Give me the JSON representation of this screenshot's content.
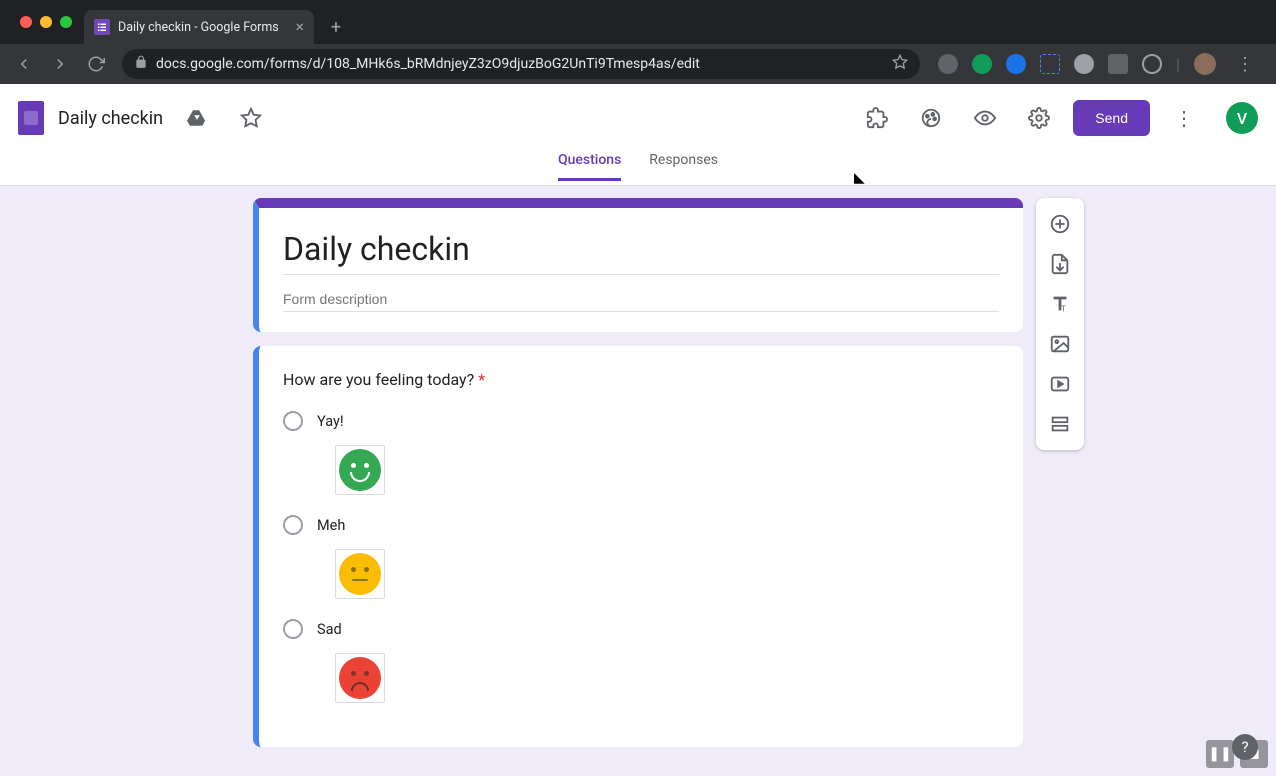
{
  "browser": {
    "tab_title": "Daily checkin - Google Forms",
    "url": "docs.google.com/forms/d/108_MHk6s_bRMdnjeyZ3zO9djuzBoG2UnTi9Tmesp4as/edit"
  },
  "header": {
    "form_name": "Daily checkin",
    "send_label": "Send",
    "avatar_letter": "V"
  },
  "tabs": {
    "questions": "Questions",
    "responses": "Responses"
  },
  "form": {
    "title": "Daily checkin",
    "desc_placeholder": "Form description",
    "question": {
      "text": "How are you feeling today?",
      "options": [
        {
          "label": "Yay!",
          "face": "green"
        },
        {
          "label": "Meh",
          "face": "yellow"
        },
        {
          "label": "Sad",
          "face": "red"
        }
      ]
    }
  },
  "help_label": "?"
}
